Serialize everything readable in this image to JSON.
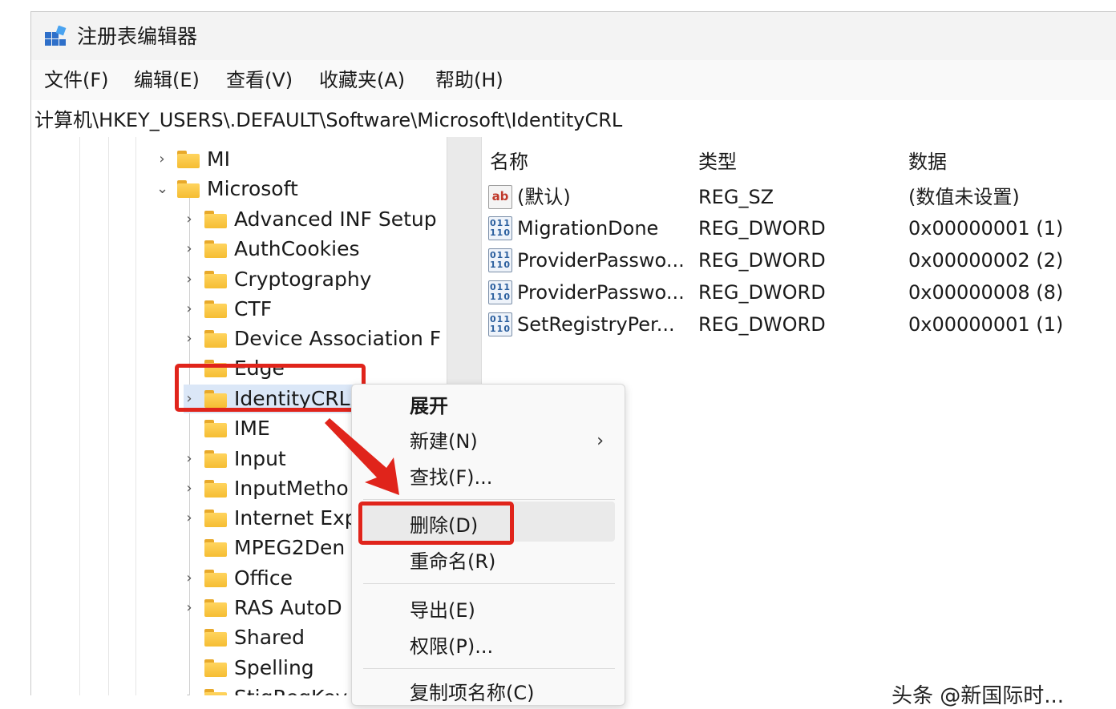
{
  "window": {
    "title": "注册表编辑器"
  },
  "menubar": {
    "items": [
      "文件(F)",
      "编辑(E)",
      "查看(V)",
      "收藏夹(A)",
      "帮助(H)"
    ]
  },
  "address": {
    "path": "计算机\\HKEY_USERS\\.DEFAULT\\Software\\Microsoft\\IdentityCRL"
  },
  "tree": {
    "items": [
      {
        "label": "MI",
        "expanded": false,
        "has_children": true
      },
      {
        "label": "Microsoft",
        "expanded": true,
        "has_children": true
      },
      {
        "label": "Advanced INF Setup",
        "has_children": true
      },
      {
        "label": "AuthCookies",
        "has_children": true
      },
      {
        "label": "Cryptography",
        "has_children": true
      },
      {
        "label": "CTF",
        "has_children": true
      },
      {
        "label": "Device Association F",
        "has_children": true
      },
      {
        "label": "Edge",
        "has_children": false
      },
      {
        "label": "IdentityCRL",
        "has_children": true,
        "selected": true
      },
      {
        "label": "IME",
        "has_children": false
      },
      {
        "label": "Input",
        "has_children": true
      },
      {
        "label": "InputMetho",
        "has_children": true
      },
      {
        "label": "Internet Exp",
        "has_children": true
      },
      {
        "label": "MPEG2Den",
        "has_children": false
      },
      {
        "label": "Office",
        "has_children": true
      },
      {
        "label": "RAS AutoD",
        "has_children": true
      },
      {
        "label": "Shared",
        "has_children": false
      },
      {
        "label": "Spelling",
        "has_children": false
      },
      {
        "label": "StigRegKey",
        "has_children": true
      }
    ]
  },
  "values": {
    "headers": {
      "name": "名称",
      "type": "类型",
      "data": "数据"
    },
    "rows": [
      {
        "icon": "string-value-icon",
        "icon_text": "ab",
        "name": "(默认)",
        "type": "REG_SZ",
        "data": "(数值未设置)"
      },
      {
        "icon": "binary-value-icon",
        "icon_text": "011\n110",
        "name": "MigrationDone",
        "type": "REG_DWORD",
        "data": "0x00000001 (1)"
      },
      {
        "icon": "binary-value-icon",
        "icon_text": "011\n110",
        "name": "ProviderPasswo...",
        "type": "REG_DWORD",
        "data": "0x00000002 (2)"
      },
      {
        "icon": "binary-value-icon",
        "icon_text": "011\n110",
        "name": "ProviderPasswo...",
        "type": "REG_DWORD",
        "data": "0x00000008 (8)"
      },
      {
        "icon": "binary-value-icon",
        "icon_text": "011\n110",
        "name": "SetRegistryPer...",
        "type": "REG_DWORD",
        "data": "0x00000001 (1)"
      }
    ]
  },
  "context_menu": {
    "expand": "展开",
    "new": "新建(N)",
    "new_arrow": "›",
    "find": "查找(F)...",
    "delete": "删除(D)",
    "rename": "重命名(R)",
    "export": "导出(E)",
    "permissions": "权限(P)...",
    "copy_key_name": "复制项名称(C)"
  },
  "watermark": {
    "text": "头条 @新国际时..."
  },
  "colors": {
    "highlight": "#e0241b",
    "folder": "#f5bd33",
    "selected_row": "#dbe7f7"
  }
}
